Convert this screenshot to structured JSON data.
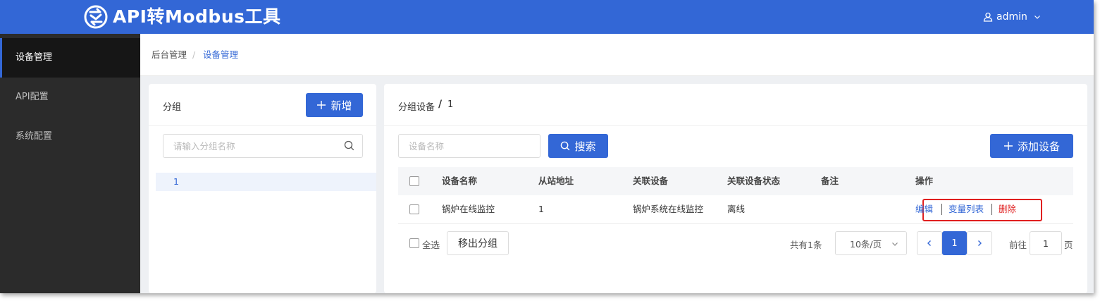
{
  "header": {
    "app_title": "API转Modbus工具",
    "user_name": "admin",
    "brand_color": "#3367d6"
  },
  "sidebar": {
    "items": [
      {
        "label": "设备管理",
        "active": true
      },
      {
        "label": "API配置",
        "active": false
      },
      {
        "label": "系统配置",
        "active": false
      }
    ]
  },
  "breadcrumb": {
    "parent": "后台管理",
    "separator": "/",
    "current": "设备管理"
  },
  "group_panel": {
    "title": "分组",
    "add_button": "新增",
    "search_placeholder": "请输入分组名称",
    "groups": [
      {
        "name": "1",
        "selected": true
      }
    ]
  },
  "device_panel": {
    "title_label": "分组设备",
    "title_separator": "/",
    "title_group": "1",
    "search_placeholder": "设备名称",
    "search_button": "搜索",
    "add_button": "添加设备",
    "table": {
      "columns": [
        "设备名称",
        "从站地址",
        "关联设备",
        "关联设备状态",
        "备注",
        "操作"
      ],
      "rows": [
        {
          "name": "锅炉在线监控",
          "slave_address": "1",
          "linked_device": "锅炉系统在线监控",
          "linked_status": "离线",
          "remark": ""
        }
      ],
      "actions": {
        "edit": "编辑",
        "variables": "变量列表",
        "delete": "删除"
      }
    },
    "footer": {
      "select_all": "全选",
      "remove_button": "移出分组",
      "total": "共有1条",
      "page_size": "10条/页",
      "current_page": "1",
      "goto_prefix": "前往",
      "goto_value": "1",
      "goto_suffix": "页"
    }
  },
  "colors": {
    "accent": "#3367d6",
    "danger": "#e02020",
    "sidebar_bg": "#2b2b2b",
    "highlight_box": "#e02020"
  }
}
